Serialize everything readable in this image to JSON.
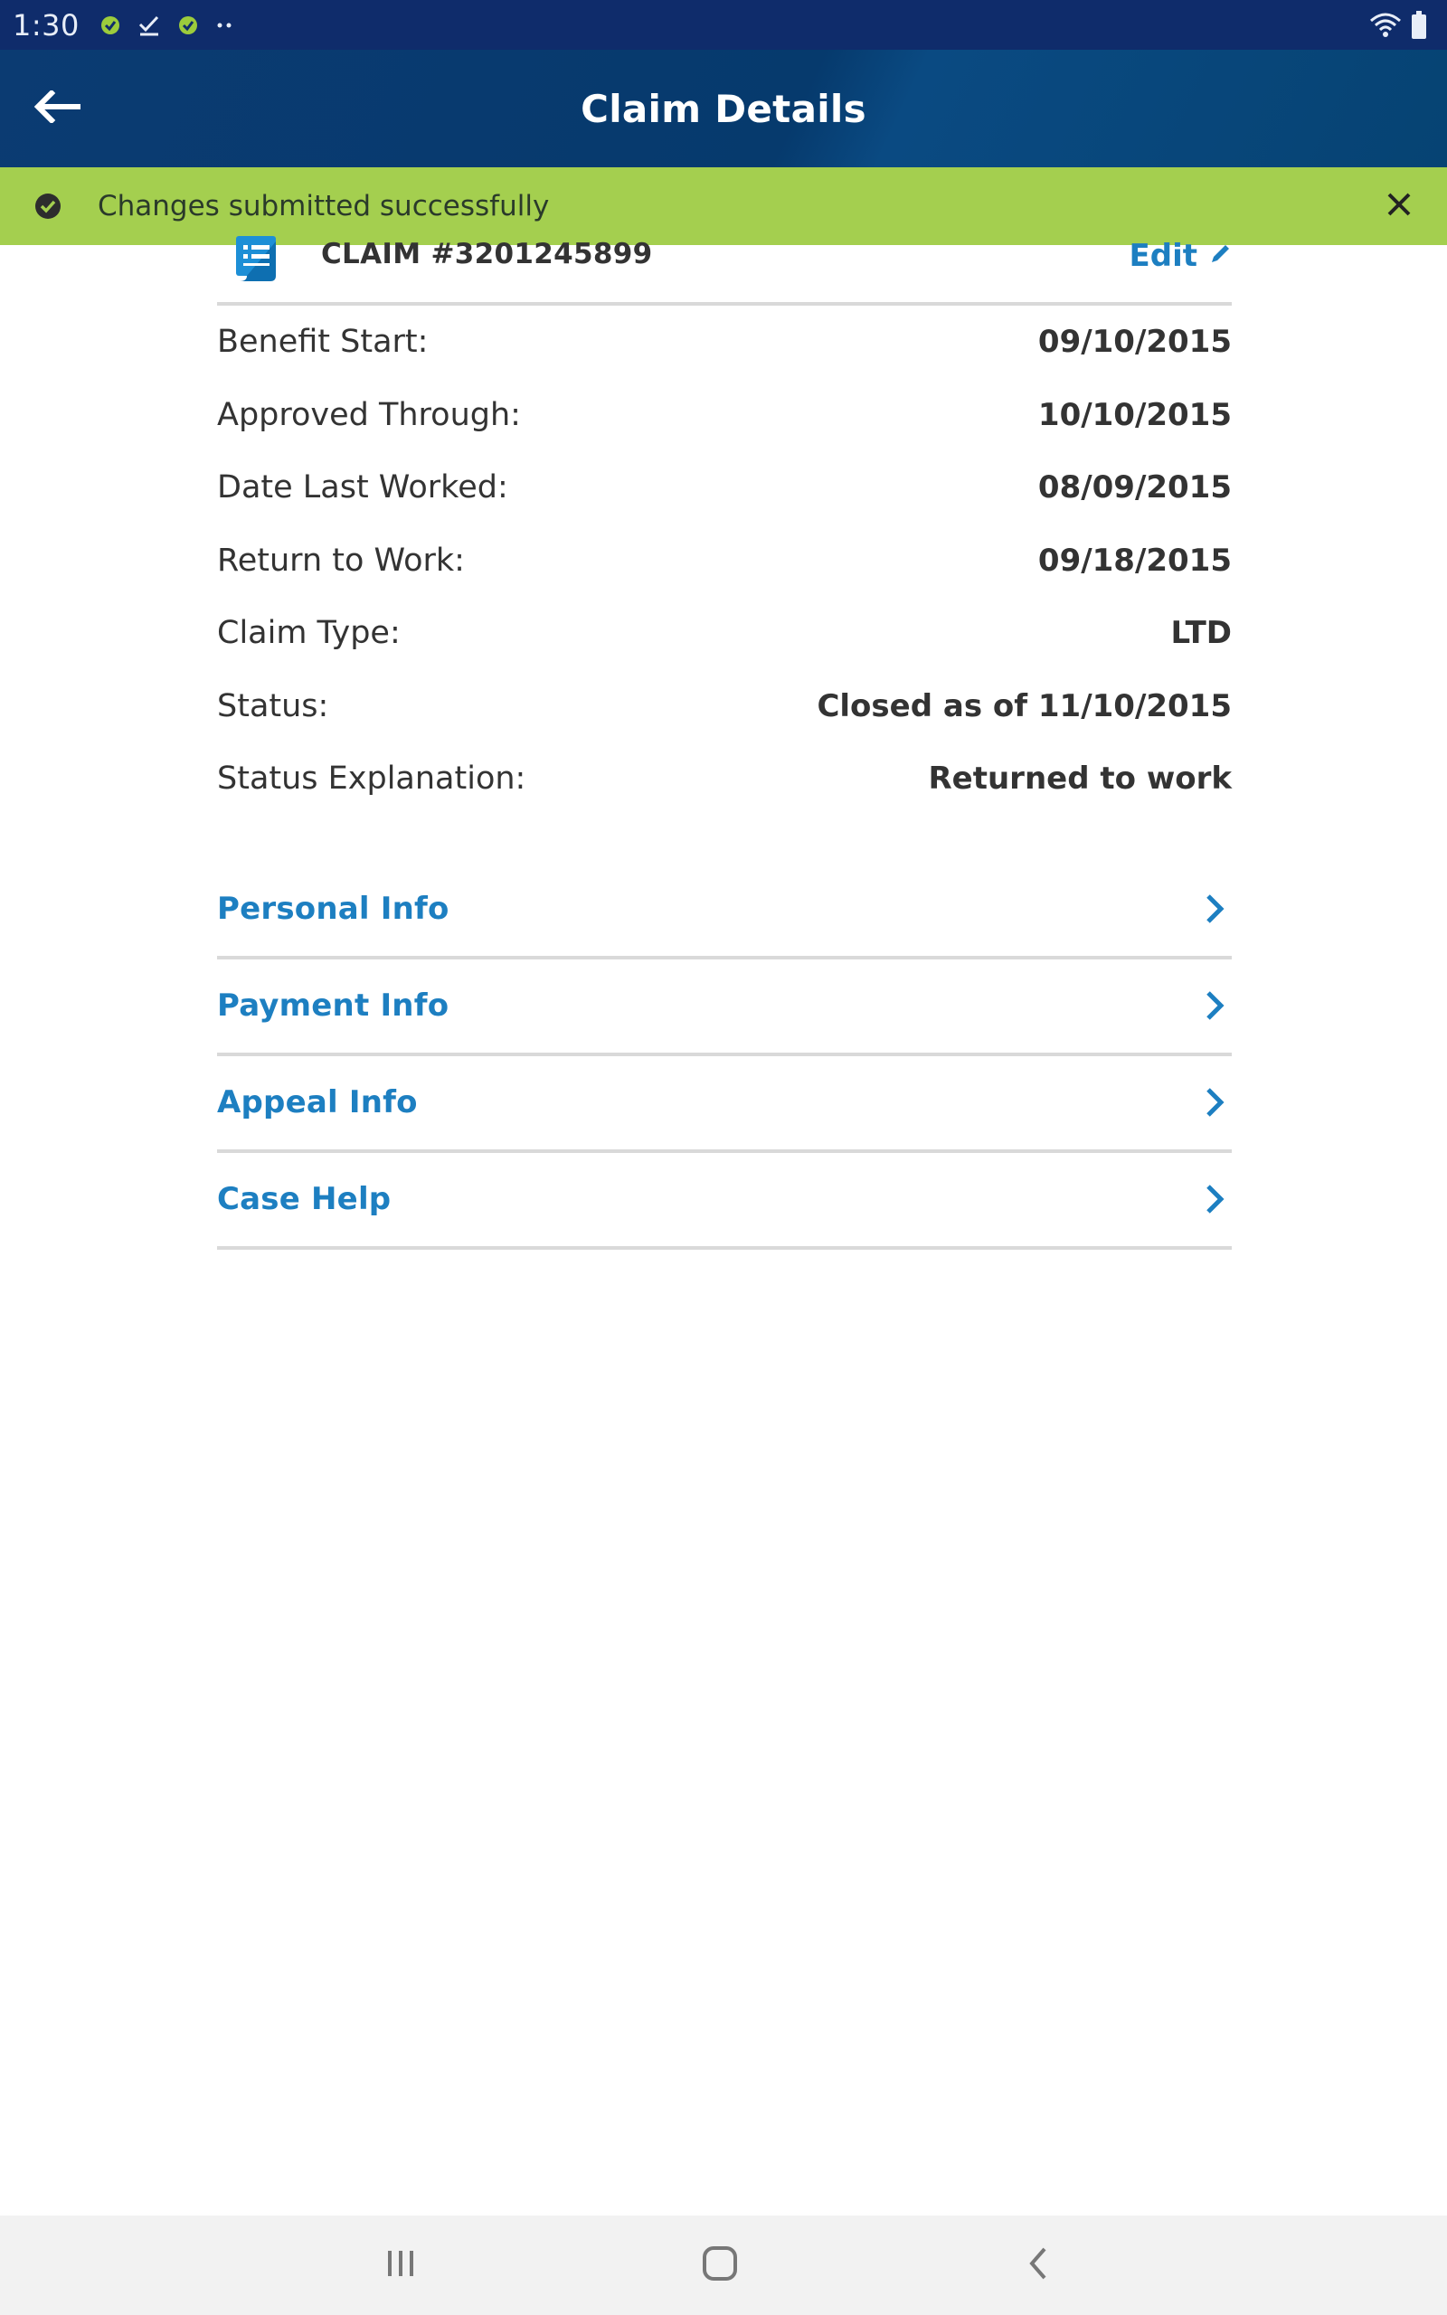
{
  "status_bar": {
    "time": "1:30",
    "icons": [
      "app-notification-icon",
      "checkmark-icon",
      "app-notification-icon",
      "more-dots-icon"
    ],
    "right_icons": [
      "wifi-icon",
      "battery-icon"
    ]
  },
  "app_bar": {
    "title": "Claim Details",
    "back_icon": "arrow-left-icon"
  },
  "banner": {
    "message": "Changes submitted successfully",
    "color": "#a4cf4f"
  },
  "claim": {
    "number": "CLAIM #3201245899",
    "edit_label": "Edit",
    "details": [
      {
        "label": "Benefit Start:",
        "value": "09/10/2015"
      },
      {
        "label": "Approved Through:",
        "value": "10/10/2015"
      },
      {
        "label": "Date Last Worked:",
        "value": "08/09/2015"
      },
      {
        "label": "Return to Work:",
        "value": "09/18/2015"
      },
      {
        "label": "Claim Type:",
        "value": "LTD"
      },
      {
        "label": "Status:",
        "value": "Closed as of 11/10/2015"
      },
      {
        "label": "Status Explanation:",
        "value": "Returned to work"
      }
    ]
  },
  "links": [
    {
      "label": "Personal Info"
    },
    {
      "label": "Payment Info"
    },
    {
      "label": "Appeal Info"
    },
    {
      "label": "Case Help"
    }
  ],
  "colors": {
    "accent": "#1d7fc1",
    "header": "#063a6d",
    "status_bar": "#0f2c6b"
  },
  "nav_bar": {
    "icons": [
      "recent-apps-icon",
      "home-icon",
      "back-chevron-icon"
    ]
  }
}
